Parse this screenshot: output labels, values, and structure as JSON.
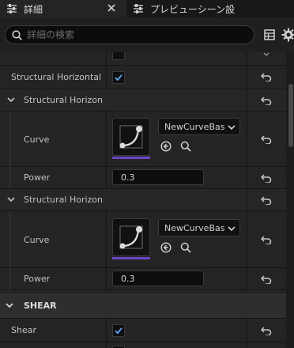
{
  "tabs": {
    "details_label": "詳細",
    "preview_label": "プレビューシーン設"
  },
  "search": {
    "placeholder": "詳細の検索",
    "value": ""
  },
  "rows": {
    "structural_horizontal_top": {
      "label": "Structural Horizontal C",
      "checked": true
    },
    "group1": {
      "label": "Structural Horizontal"
    },
    "group1_curve": {
      "label": "Curve",
      "asset": "NewCurveBas"
    },
    "group1_power": {
      "label": "Power",
      "value": "0.3"
    },
    "group2": {
      "label": "Structural Horizontal"
    },
    "group2_curve": {
      "label": "Curve",
      "asset": "NewCurveBas"
    },
    "group2_power": {
      "label": "Power",
      "value": "0.3"
    },
    "shear_section": {
      "label": "SHEAR"
    },
    "shear": {
      "label": "Shear",
      "checked": true
    }
  },
  "colors": {
    "checkbox_check": "#5aa9ff",
    "curve_underline": "#6a45c8",
    "panel_bg": "#242424"
  },
  "icons": {
    "details_tab": "sliders-icon",
    "close_tab": "close-icon",
    "preview_tab": "sliders-icon",
    "search": "search-icon",
    "grid_view": "grid-icon",
    "settings": "gear-icon",
    "reset": "reset-arrow-icon",
    "expand": "chevron-down-icon",
    "browse": "arrow-left-circle-icon",
    "find": "magnifier-icon"
  }
}
